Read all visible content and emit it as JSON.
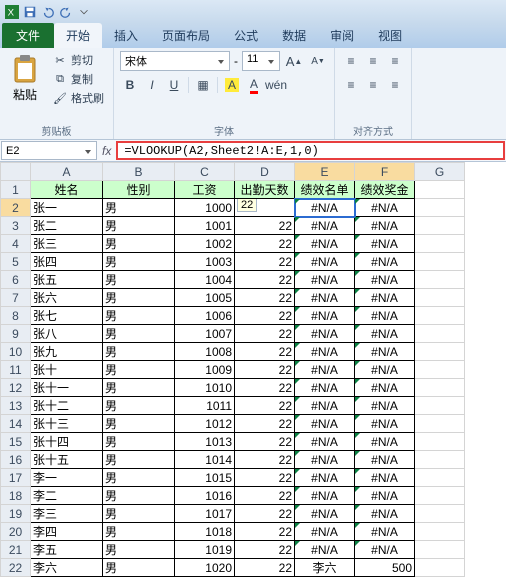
{
  "qat": {
    "excel_icon": "X",
    "save_icon": "save",
    "undo_icon": "undo",
    "redo_icon": "redo"
  },
  "tabs": {
    "file": "文件",
    "home": "开始",
    "insert": "插入",
    "layout": "页面布局",
    "formulas": "公式",
    "data": "数据",
    "review": "审阅",
    "view": "视图"
  },
  "clipboard": {
    "paste": "粘贴",
    "cut": "剪切",
    "copy": "复制",
    "format_painter": "格式刷",
    "group_label": "剪贴板"
  },
  "font": {
    "face": "宋体",
    "size": "11",
    "group_label": "字体"
  },
  "align": {
    "group_label": "对齐方式"
  },
  "namebox": "E2",
  "formula": "=VLOOKUP(A2,Sheet2!A:E,1,0)",
  "fx": "fx",
  "columns": [
    "A",
    "B",
    "C",
    "D",
    "E",
    "F",
    "G"
  ],
  "headers": {
    "A": "姓名",
    "B": "性别",
    "C": "工资",
    "D": "出勤天数",
    "E": "绩效名单",
    "F": "绩效奖金"
  },
  "rows": [
    {
      "r": 2,
      "A": "张一",
      "B": "男",
      "C": "1000",
      "D": "22",
      "E": "#N/A",
      "F": "#N/A"
    },
    {
      "r": 3,
      "A": "张二",
      "B": "男",
      "C": "1001",
      "D": "22",
      "E": "#N/A",
      "F": "#N/A"
    },
    {
      "r": 4,
      "A": "张三",
      "B": "男",
      "C": "1002",
      "D": "22",
      "E": "#N/A",
      "F": "#N/A"
    },
    {
      "r": 5,
      "A": "张四",
      "B": "男",
      "C": "1003",
      "D": "22",
      "E": "#N/A",
      "F": "#N/A"
    },
    {
      "r": 6,
      "A": "张五",
      "B": "男",
      "C": "1004",
      "D": "22",
      "E": "#N/A",
      "F": "#N/A"
    },
    {
      "r": 7,
      "A": "张六",
      "B": "男",
      "C": "1005",
      "D": "22",
      "E": "#N/A",
      "F": "#N/A"
    },
    {
      "r": 8,
      "A": "张七",
      "B": "男",
      "C": "1006",
      "D": "22",
      "E": "#N/A",
      "F": "#N/A"
    },
    {
      "r": 9,
      "A": "张八",
      "B": "男",
      "C": "1007",
      "D": "22",
      "E": "#N/A",
      "F": "#N/A"
    },
    {
      "r": 10,
      "A": "张九",
      "B": "男",
      "C": "1008",
      "D": "22",
      "E": "#N/A",
      "F": "#N/A"
    },
    {
      "r": 11,
      "A": "张十",
      "B": "男",
      "C": "1009",
      "D": "22",
      "E": "#N/A",
      "F": "#N/A"
    },
    {
      "r": 12,
      "A": "张十一",
      "B": "男",
      "C": "1010",
      "D": "22",
      "E": "#N/A",
      "F": "#N/A"
    },
    {
      "r": 13,
      "A": "张十二",
      "B": "男",
      "C": "1011",
      "D": "22",
      "E": "#N/A",
      "F": "#N/A"
    },
    {
      "r": 14,
      "A": "张十三",
      "B": "男",
      "C": "1012",
      "D": "22",
      "E": "#N/A",
      "F": "#N/A"
    },
    {
      "r": 15,
      "A": "张十四",
      "B": "男",
      "C": "1013",
      "D": "22",
      "E": "#N/A",
      "F": "#N/A"
    },
    {
      "r": 16,
      "A": "张十五",
      "B": "男",
      "C": "1014",
      "D": "22",
      "E": "#N/A",
      "F": "#N/A"
    },
    {
      "r": 17,
      "A": "李一",
      "B": "男",
      "C": "1015",
      "D": "22",
      "E": "#N/A",
      "F": "#N/A"
    },
    {
      "r": 18,
      "A": "李二",
      "B": "男",
      "C": "1016",
      "D": "22",
      "E": "#N/A",
      "F": "#N/A"
    },
    {
      "r": 19,
      "A": "李三",
      "B": "男",
      "C": "1017",
      "D": "22",
      "E": "#N/A",
      "F": "#N/A"
    },
    {
      "r": 20,
      "A": "李四",
      "B": "男",
      "C": "1018",
      "D": "22",
      "E": "#N/A",
      "F": "#N/A"
    },
    {
      "r": 21,
      "A": "李五",
      "B": "男",
      "C": "1019",
      "D": "22",
      "E": "#N/A",
      "F": "#N/A"
    },
    {
      "r": 22,
      "A": "李六",
      "B": "男",
      "C": "1020",
      "D": "22",
      "E": "李六",
      "F": "500"
    }
  ],
  "hint_cell": "22"
}
